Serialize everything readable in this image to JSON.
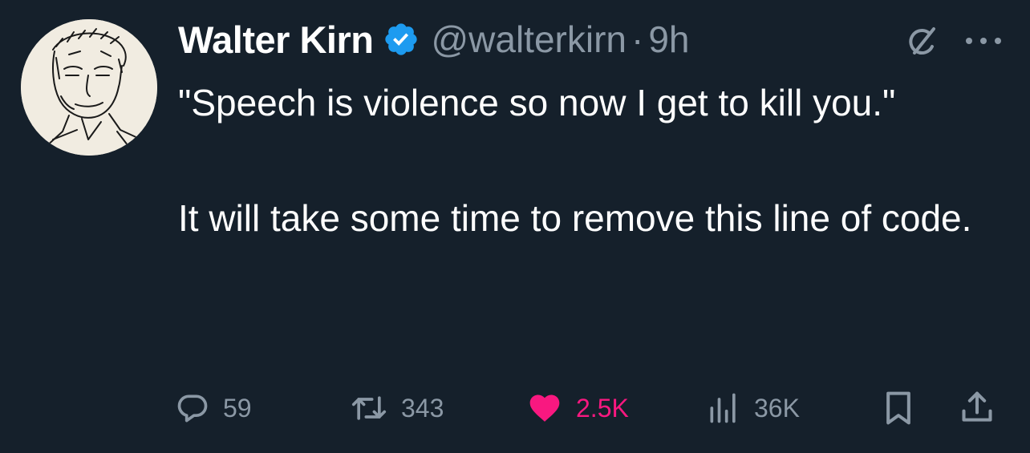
{
  "author": {
    "display_name": "Walter Kirn",
    "handle": "@walterkirn",
    "separator": "·",
    "time": "9h",
    "verified": true,
    "avatar": "sketch-portrait"
  },
  "tweet": {
    "line1": "\"Speech is violence so now I get to kill you.\"",
    "line2": "It will take some time to remove this line of code."
  },
  "actions": {
    "reply_count": "59",
    "retweet_count": "343",
    "like_count": "2.5K",
    "view_count": "36K",
    "liked": true
  },
  "icons": {
    "verified": "verified-badge-icon",
    "grok": "grok-icon",
    "more": "more-dots-icon",
    "reply": "reply-bubble-icon",
    "retweet": "retweet-icon",
    "like": "heart-icon",
    "views": "views-bar-chart-icon",
    "bookmark": "bookmark-icon",
    "share": "share-upload-icon"
  },
  "colors": {
    "background": "#15202b",
    "text": "#ffffff",
    "muted": "#8b98a5",
    "verified": "#1d9bf0",
    "like": "#f91880"
  }
}
